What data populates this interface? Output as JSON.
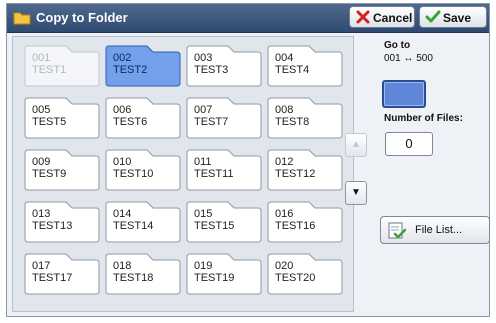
{
  "header": {
    "title": "Copy to Folder",
    "title_icon": "folder-icon",
    "cancel_label": "Cancel",
    "cancel_icon": "red-x-icon",
    "save_label": "Save",
    "save_icon": "checkmark-icon"
  },
  "folders": [
    {
      "number": "001",
      "name": "TEST1",
      "state": "disabled"
    },
    {
      "number": "002",
      "name": "TEST2",
      "state": "selected"
    },
    {
      "number": "003",
      "name": "TEST3",
      "state": "normal"
    },
    {
      "number": "004",
      "name": "TEST4",
      "state": "normal"
    },
    {
      "number": "005",
      "name": "TEST5",
      "state": "normal"
    },
    {
      "number": "006",
      "name": "TEST6",
      "state": "normal"
    },
    {
      "number": "007",
      "name": "TEST7",
      "state": "normal"
    },
    {
      "number": "008",
      "name": "TEST8",
      "state": "normal"
    },
    {
      "number": "009",
      "name": "TEST9",
      "state": "normal"
    },
    {
      "number": "010",
      "name": "TEST10",
      "state": "normal"
    },
    {
      "number": "011",
      "name": "TEST11",
      "state": "normal"
    },
    {
      "number": "012",
      "name": "TEST12",
      "state": "normal"
    },
    {
      "number": "013",
      "name": "TEST13",
      "state": "normal"
    },
    {
      "number": "014",
      "name": "TEST14",
      "state": "normal"
    },
    {
      "number": "015",
      "name": "TEST15",
      "state": "normal"
    },
    {
      "number": "016",
      "name": "TEST16",
      "state": "normal"
    },
    {
      "number": "017",
      "name": "TEST17",
      "state": "normal"
    },
    {
      "number": "018",
      "name": "TEST18",
      "state": "normal"
    },
    {
      "number": "019",
      "name": "TEST19",
      "state": "normal"
    },
    {
      "number": "020",
      "name": "TEST20",
      "state": "normal"
    }
  ],
  "side": {
    "goto_label": "Go to",
    "goto_range": "001 ↔ 500",
    "num_files_label": "Number of Files:",
    "num_files_value": "0",
    "file_list_label": "File List...",
    "file_list_icon": "document-check-icon",
    "scroll_up_icon": "triangle-up-icon",
    "scroll_down_icon": "triangle-down-icon",
    "scroll_up_enabled": false,
    "scroll_down_enabled": true
  },
  "colors": {
    "title_bar": "#3d5a80",
    "selected_folder": "#6f96e0",
    "goto_button": "#5f86d8"
  }
}
